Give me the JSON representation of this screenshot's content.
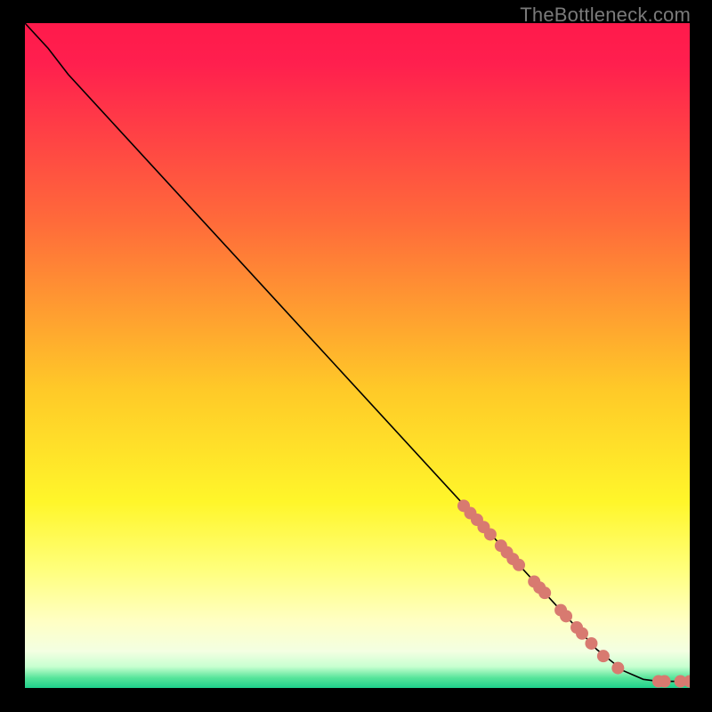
{
  "brand": "TheBottleneck.com",
  "chart_data": {
    "type": "line",
    "title": "",
    "xlabel": "",
    "ylabel": "",
    "xlim": [
      0,
      100
    ],
    "ylim": [
      0,
      100
    ],
    "background_gradient": {
      "stops": [
        {
          "offset": 0.0,
          "color": "#ff1a4b"
        },
        {
          "offset": 0.06,
          "color": "#ff1f4e"
        },
        {
          "offset": 0.3,
          "color": "#ff6b3a"
        },
        {
          "offset": 0.55,
          "color": "#ffc928"
        },
        {
          "offset": 0.72,
          "color": "#fff62a"
        },
        {
          "offset": 0.82,
          "color": "#ffff7a"
        },
        {
          "offset": 0.9,
          "color": "#ffffc4"
        },
        {
          "offset": 0.945,
          "color": "#f3ffe2"
        },
        {
          "offset": 0.968,
          "color": "#c7ffd0"
        },
        {
          "offset": 0.985,
          "color": "#56e49a"
        },
        {
          "offset": 1.0,
          "color": "#1fcf8b"
        }
      ]
    },
    "series": [
      {
        "name": "curve",
        "color": "#000000",
        "points": [
          {
            "x": 0.0,
            "y": 100.0
          },
          {
            "x": 3.5,
            "y": 96.2
          },
          {
            "x": 6.5,
            "y": 92.3
          },
          {
            "x": 78.0,
            "y": 14.5
          },
          {
            "x": 86.0,
            "y": 5.8
          },
          {
            "x": 90.0,
            "y": 2.6
          },
          {
            "x": 93.0,
            "y": 1.3
          },
          {
            "x": 95.3,
            "y": 1.0
          },
          {
            "x": 96.2,
            "y": 1.0
          },
          {
            "x": 98.6,
            "y": 1.0
          },
          {
            "x": 100.0,
            "y": 1.0
          }
        ]
      }
    ],
    "markers": {
      "color": "#d87a70",
      "radius_px": 7,
      "points": [
        {
          "x": 66.0,
          "y": 27.4
        },
        {
          "x": 67.0,
          "y": 26.3
        },
        {
          "x": 68.0,
          "y": 25.3
        },
        {
          "x": 69.0,
          "y": 24.2
        },
        {
          "x": 70.0,
          "y": 23.1
        },
        {
          "x": 71.6,
          "y": 21.4
        },
        {
          "x": 72.5,
          "y": 20.4
        },
        {
          "x": 73.4,
          "y": 19.4
        },
        {
          "x": 74.3,
          "y": 18.5
        },
        {
          "x": 76.6,
          "y": 16.0
        },
        {
          "x": 77.4,
          "y": 15.1
        },
        {
          "x": 78.2,
          "y": 14.3
        },
        {
          "x": 80.6,
          "y": 11.7
        },
        {
          "x": 81.4,
          "y": 10.8
        },
        {
          "x": 83.0,
          "y": 9.1
        },
        {
          "x": 83.8,
          "y": 8.2
        },
        {
          "x": 85.2,
          "y": 6.7
        },
        {
          "x": 87.0,
          "y": 4.8
        },
        {
          "x": 89.2,
          "y": 3.0
        },
        {
          "x": 95.3,
          "y": 1.0
        },
        {
          "x": 96.2,
          "y": 1.0
        },
        {
          "x": 98.6,
          "y": 1.0
        },
        {
          "x": 100.0,
          "y": 1.0
        }
      ]
    }
  }
}
